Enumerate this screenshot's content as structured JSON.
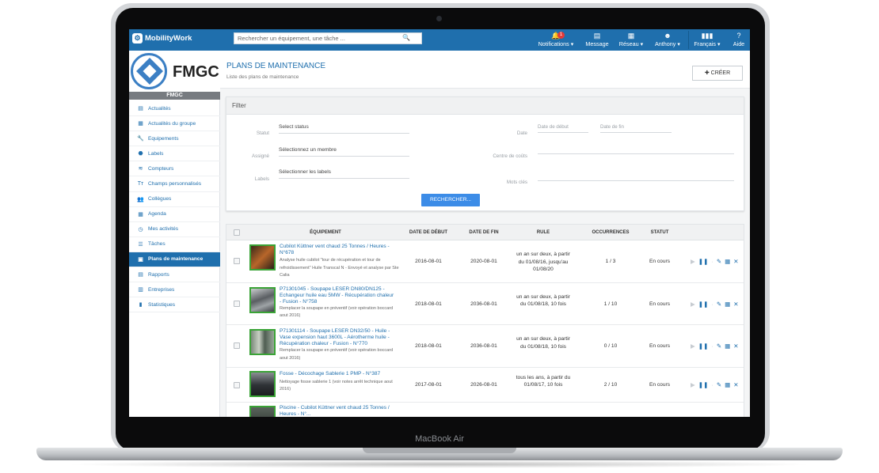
{
  "device": {
    "brand": "MacBook Air"
  },
  "topbar": {
    "brand": "MobilityWork",
    "search_placeholder": "Rechercher un équipement, une tâche ...",
    "notifications": {
      "label": "Notifications",
      "count": "1"
    },
    "message_label": "Message",
    "reseau_label": "Réseau",
    "user_label": "Anthony",
    "language_label": "Français",
    "help_label": "Aide"
  },
  "org": {
    "name": "FMGC",
    "label": "FMGC"
  },
  "sidebar": {
    "items": [
      {
        "label": "Actualités",
        "icon": "newspaper-icon"
      },
      {
        "label": "Actualités du groupe",
        "icon": "group-news-icon"
      },
      {
        "label": "Equipements",
        "icon": "wrench-icon"
      },
      {
        "label": "Labels",
        "icon": "tag-icon"
      },
      {
        "label": "Compteurs",
        "icon": "wifi-icon"
      },
      {
        "label": "Champs personnalisés",
        "icon": "text-icon"
      },
      {
        "label": "Collègues",
        "icon": "users-icon"
      },
      {
        "label": "Agenda",
        "icon": "calendar-icon"
      },
      {
        "label": "Mes activités",
        "icon": "clock-icon"
      },
      {
        "label": "Tâches",
        "icon": "list-icon"
      },
      {
        "label": "Plans de maintenance",
        "icon": "calendar-plan-icon",
        "active": true
      },
      {
        "label": "Rapports",
        "icon": "report-icon"
      },
      {
        "label": "Entreprises",
        "icon": "building-icon"
      },
      {
        "label": "Statistiques",
        "icon": "bar-chart-icon"
      }
    ]
  },
  "page": {
    "title": "PLANS DE MAINTENANCE",
    "subtitle": "Liste des plans de maintenance",
    "create_label": "CRÉER"
  },
  "filter": {
    "title": "Filter",
    "statut_label": "Statut",
    "statut_value": "Select status",
    "assigne_label": "Assigné",
    "assigne_value": "Sélectionnez un membre",
    "labels_label": "Labels",
    "labels_value": "Sélectionner les labels",
    "date_label": "Date",
    "date_debut_placeholder": "Date de début",
    "date_fin_placeholder": "Date de fin",
    "centre_couts_label": "Centre de coûts",
    "mots_cles_label": "Mots clés",
    "search_button": "RECHERCHER..."
  },
  "table": {
    "headers": {
      "equipement": "ÉQUIPEMENT",
      "date_debut": "DATE DE DÉBUT",
      "date_fin": "DATE DE FIN",
      "rule": "RULE",
      "occurrences": "OCCURRENCES",
      "statut": "STATUT"
    },
    "rows": [
      {
        "title": "Cubilot Küttner vent chaud 25 Tonnes / Heures - N°678",
        "desc": "Analyse huile cubilot \"tour de récupération et tour de refroidissement\" Huile Transcal N - Envoyé et analyse par Ste Calia",
        "start": "2016-08-01",
        "end": "2020-08-01",
        "rule": "un an sur deux, à partir du 01/08/16, jusqu'au 01/08/20",
        "occurrences": "1 / 3",
        "status": "En cours"
      },
      {
        "title": "P71301045 - Soupape LESER DN80/DN125 - Echangeur huile eau 5MW - Récupération chaleur - Fusion - N°758",
        "desc": "Remplacer la soupape en préventif (voir opération boccard aout 2016)",
        "start": "2018-08-01",
        "end": "2036-08-01",
        "rule": "un an sur deux, à partir du 01/08/18, 10 fois",
        "occurrences": "1 / 10",
        "status": "En cours"
      },
      {
        "title": "P71301114 - Soupape LESER DN32/50 - Huile - Vase expension haut 3600L - Aérotherme huile - Récupération chaleur - Fusion - N°770",
        "desc": "Remplacer la soupape en préventif (voir opération boccard aout 2016)",
        "start": "2018-08-01",
        "end": "2036-08-01",
        "rule": "un an sur deux, à partir du 01/08/18, 10 fois",
        "occurrences": "0 / 10",
        "status": "En cours"
      },
      {
        "title": "Fosse - Décochage Sablerie 1 PMP - N°387",
        "desc": "Nettoyage fosse sablerie 1 (voir notes arrêt technique aout 2016)",
        "start": "2017-08-01",
        "end": "2026-08-01",
        "rule": "tous les ans, à partir du 01/08/17, 10 fois",
        "occurrences": "2 / 10",
        "status": "En cours"
      },
      {
        "title": "Piscine - Cubilot Küttner vent chaud 25 Tonnes / Heures - N°...",
        "desc": "",
        "start": "",
        "end": "",
        "rule": "",
        "occurrences": "",
        "status": ""
      }
    ]
  },
  "colors": {
    "brand_blue": "#1f6fad",
    "button_blue": "#3c8ce7",
    "thumb_border": "#3aa336"
  }
}
